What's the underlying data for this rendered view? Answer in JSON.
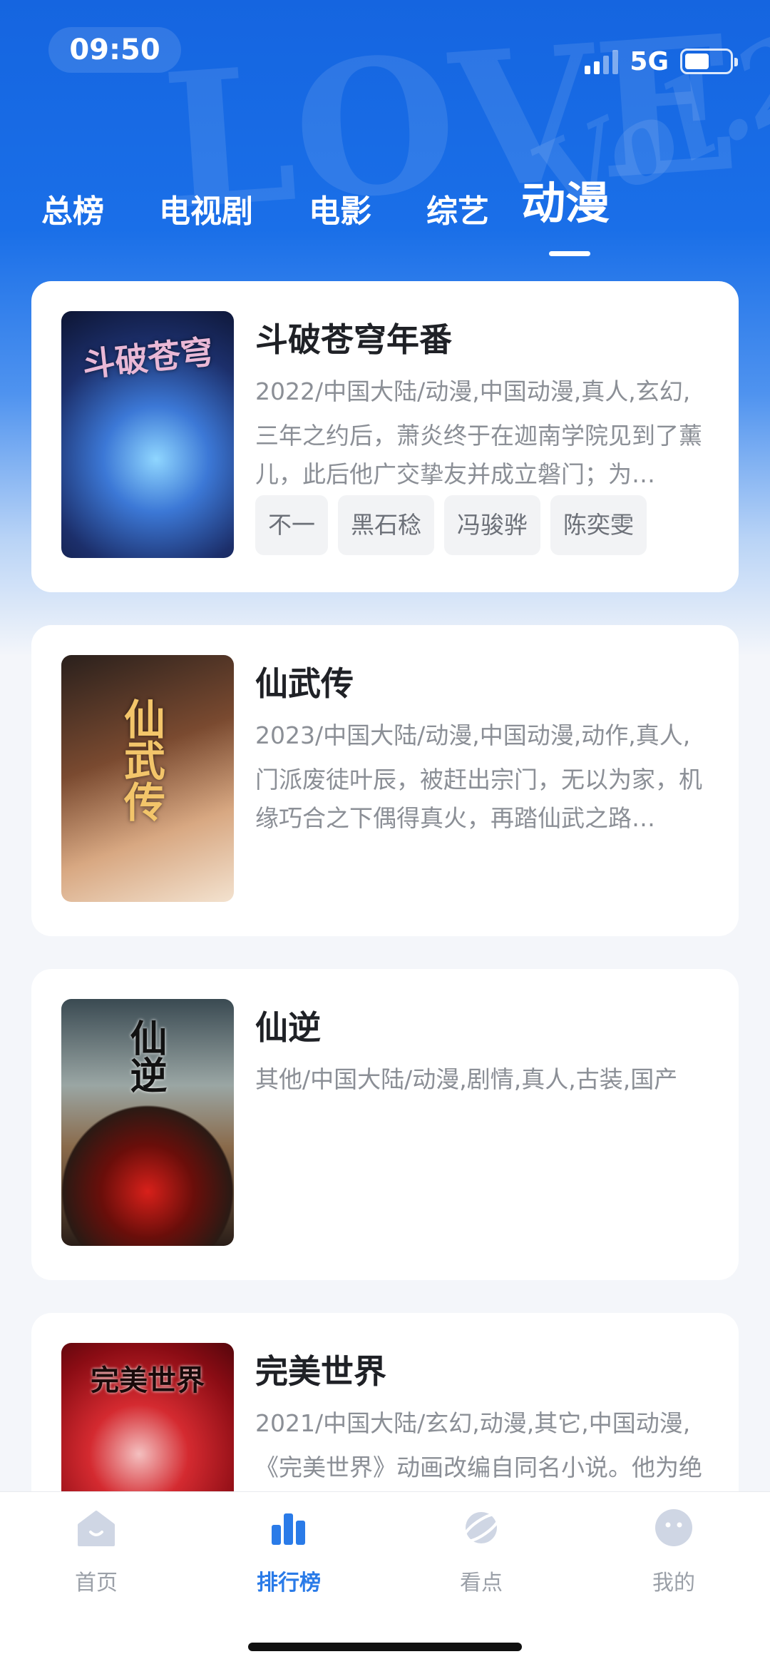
{
  "status_bar": {
    "time": "09:50",
    "network": "5G",
    "battery_level": 0.55
  },
  "tabs": [
    {
      "label": "总榜",
      "active": false
    },
    {
      "label": "电视剧",
      "active": false
    },
    {
      "label": "电影",
      "active": false
    },
    {
      "label": "综艺",
      "active": false
    },
    {
      "label": "动漫",
      "active": true
    }
  ],
  "cards": [
    {
      "title": "斗破苍穹年番",
      "meta": "2022/中国大陆/动漫,中国动漫,真人,玄幻,",
      "desc": "三年之约后，萧炎终于在迦南学院见到了薰儿，此后他广交挚友并成立磐门；为…",
      "tags": [
        "不一",
        "黑石稔",
        "冯骏骅",
        "陈奕雯"
      ],
      "poster_text": "斗破苍穹",
      "poster_colors": [
        "#1e3a7a",
        "#3d6fc4",
        "#6aa6e6"
      ]
    },
    {
      "title": "仙武传",
      "meta": "2023/中国大陆/动漫,中国动漫,动作,真人,",
      "desc": "门派废徒叶辰，被赶出宗门，无以为家，机缘巧合之下偶得真火，再踏仙武之路…",
      "tags": [],
      "poster_text": "仙武传",
      "poster_colors": [
        "#3a2a22",
        "#b07a50",
        "#e8c8a8"
      ]
    },
    {
      "title": "仙逆",
      "meta": "其他/中国大陆/动漫,剧情,真人,古装,国产",
      "desc": "",
      "tags": [],
      "poster_text": "仙逆",
      "poster_colors": [
        "#2d3a3e",
        "#7a8a86",
        "#6a1c16"
      ]
    },
    {
      "title": "完美世界",
      "meta": "2021/中国大陆/玄幻,动漫,其它,中国动漫,",
      "desc": "《完美世界》动画改编自同名小说。他为绝道而生，为巅峰而来，他身化何而去",
      "tags": [],
      "poster_text": "完美世界",
      "poster_colors": [
        "#5a0a10",
        "#c21a22",
        "#f0a0a0"
      ]
    }
  ],
  "bottom_nav": [
    {
      "label": "首页",
      "icon": "home-icon",
      "active": false
    },
    {
      "label": "排行榜",
      "icon": "chart-bar-icon",
      "active": true
    },
    {
      "label": "看点",
      "icon": "planet-icon",
      "active": false
    },
    {
      "label": "我的",
      "icon": "smiley-icon",
      "active": false
    }
  ],
  "colors": {
    "brand_blue": "#1a6fe8",
    "active_nav": "#2a7be8",
    "text_primary": "#1f2126",
    "text_secondary": "#8b8f96"
  }
}
